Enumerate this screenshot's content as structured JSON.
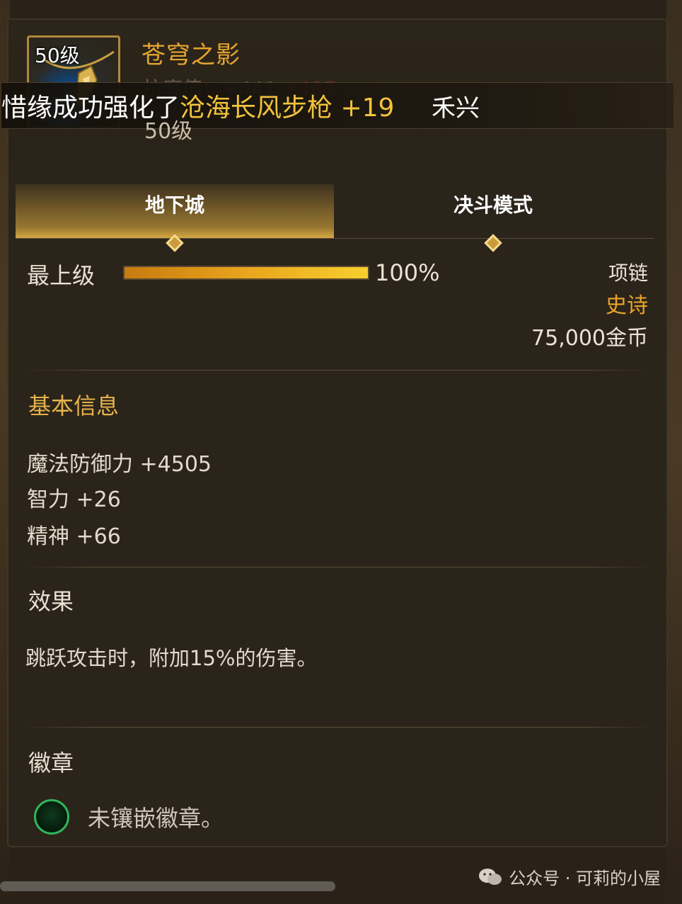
{
  "item": {
    "level_badge": "50级",
    "name": "苍穹之影",
    "ghost_stat": "抗魔值：+441",
    "ghost_stat_change": "▼487",
    "level_below": "50级"
  },
  "broadcast": {
    "prefix": "惜缘成功强化了",
    "item_name": "沧海长风步枪 +19",
    "tail": "禾兴"
  },
  "tabs": [
    {
      "label": "地下城"
    },
    {
      "label": "决斗模式"
    }
  ],
  "grade": {
    "label": "最上级",
    "percent_text": "100%",
    "fill": 1.0
  },
  "item_info": {
    "type": "项链",
    "rarity": "史诗",
    "price": "75,000金币"
  },
  "basic_info": {
    "title": "基本信息",
    "stats": [
      "魔法防御力 +4505",
      "智力 +26",
      "精神 +66"
    ]
  },
  "effect": {
    "title": "效果",
    "text": "跳跃攻击时，附加15%的伤害。"
  },
  "badge": {
    "title": "徽章",
    "text": "未镶嵌徽章。"
  },
  "watermark": "公众号 · 可莉的小屋",
  "colors": {
    "gold": "#e6a530",
    "epic": "#e9a528",
    "badge_green": "#2fb65a"
  }
}
